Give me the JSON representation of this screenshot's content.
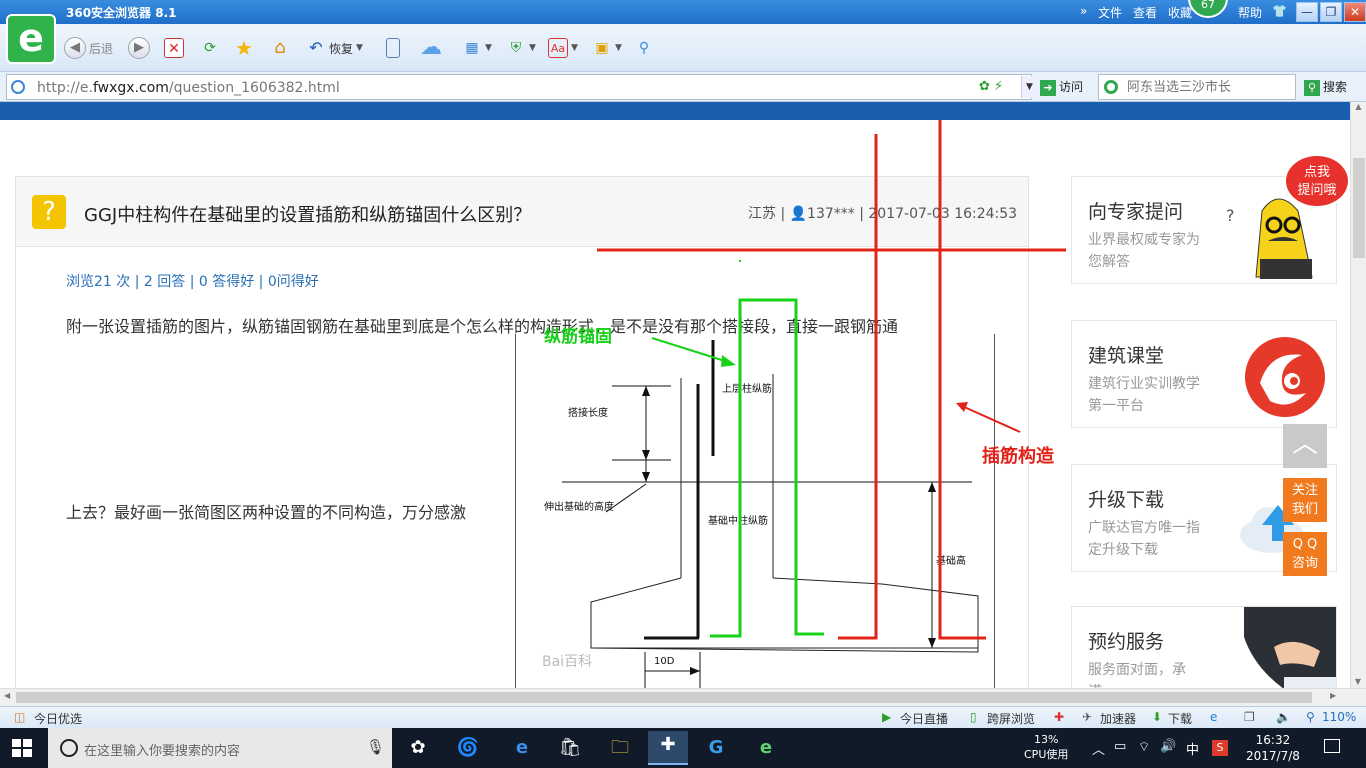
{
  "browser": {
    "window_title": "360安全浏览器 8.1",
    "menu": [
      "文件",
      "查看",
      "收藏",
      "帮助"
    ],
    "badge": "67",
    "toolbar": {
      "back": "后退",
      "restore": "恢复"
    },
    "address": {
      "url_prefix": "http://e.",
      "url_domain": "fwxgx.com",
      "url_path": "/question_1606382.html",
      "visit": "访问"
    },
    "search": {
      "placeholder": "阿东当选三沙市长",
      "button": "搜索"
    }
  },
  "question": {
    "title": "GGJ中柱构件在基础里的设置插筋和纵筋锚固什么区别？",
    "meta": "江苏 | 👤137*** | 2017-07-03 16:24:53",
    "stats": "浏览21 次 | 2 回答 | 0 答得好 | 0问得好",
    "body_line1": "附一张设置插筋的图片，纵筋锚固钢筋在基础里到底是个怎么样的构造形式，是不是没有那个搭接段，直接一跟钢筋通",
    "body_line2": "上去？最好画一张简图区两种设置的不同构造，万分感激"
  },
  "diagram": {
    "annot_green": "纵筋锚固",
    "annot_red": "插筋构造",
    "labels": {
      "lap_length": "搭接长度",
      "upper_rebar": "上层柱纵筋",
      "extend_height": "伸出基础的高度",
      "base_rebar": "基础中柱纵筋",
      "foundation_height": "基础高",
      "ten_d": "10D",
      "watermark": "Bai百科"
    }
  },
  "sidebar": {
    "ads": [
      {
        "title": "向专家提问",
        "sub": "业界最权威专家为您解答"
      },
      {
        "title": "建筑课堂",
        "sub": "建筑行业实训教学第一平台"
      },
      {
        "title": "升级下载",
        "sub": "广联达官方唯一指定升级下载"
      },
      {
        "title": "预约服务",
        "sub": "服务面对面，承诺…"
      }
    ],
    "bubble": "点我\n提问哦",
    "float_follow": "关注\n我们",
    "float_qq": "Q Q\n咨询"
  },
  "statusbar": {
    "today_pick": "今日优选",
    "live": "今日直播",
    "cross_screen": "跨屏浏览",
    "accelerator": "加速器",
    "download": "下载",
    "zoom": "110%"
  },
  "taskbar": {
    "search_placeholder": "在这里输入你要搜索的内容",
    "cpu_percent": "13%",
    "cpu_label": "CPU使用",
    "ime": "中",
    "time": "16:32",
    "date": "2017/7/8"
  },
  "colors": {
    "accent_blue": "#1a5fae",
    "green_annot": "#19d11b",
    "red_annot": "#e2231a",
    "orange_float": "#f07a1d"
  }
}
